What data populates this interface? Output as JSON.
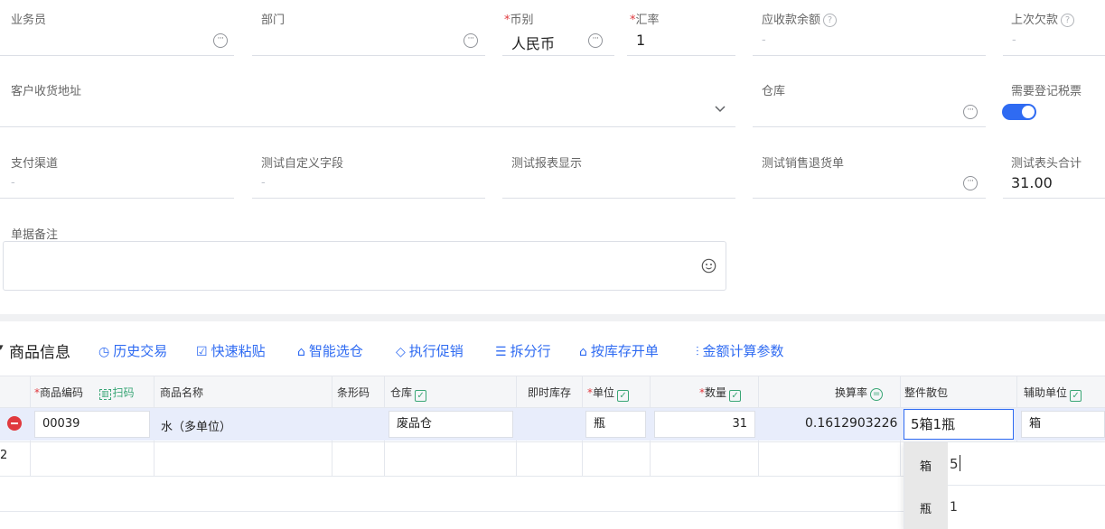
{
  "form": {
    "salesperson": {
      "label": "业务员"
    },
    "department": {
      "label": "部门"
    },
    "currency": {
      "label": "币别",
      "value": "人民币"
    },
    "exchange_rate": {
      "label": "汇率",
      "value": "1"
    },
    "receivable_balance": {
      "label": "应收款余额",
      "value": "-"
    },
    "last_owed": {
      "label": "上次欠款",
      "value": "-"
    },
    "customer_address": {
      "label": "客户收货地址"
    },
    "warehouse": {
      "label": "仓库"
    },
    "need_tax_invoice": {
      "label": "需要登记税票",
      "on": true
    },
    "payment_channel": {
      "label": "支付渠道",
      "value": "-"
    },
    "custom_field": {
      "label": "测试自定义字段",
      "value": "-"
    },
    "report_display": {
      "label": "测试报表显示"
    },
    "sales_return": {
      "label": "测试销售退货单"
    },
    "header_total": {
      "label": "测试表头合计",
      "value": "31.00"
    },
    "remarks": {
      "label": "单据备注"
    }
  },
  "section": {
    "title": "商品信息",
    "actions": [
      {
        "label": "历史交易",
        "icon": "clock-icon"
      },
      {
        "label": "快速粘贴",
        "icon": "paste-icon"
      },
      {
        "label": "智能选仓",
        "icon": "warehouse-icon"
      },
      {
        "label": "执行促销",
        "icon": "tag-icon"
      },
      {
        "label": "拆分行",
        "icon": "split-icon"
      },
      {
        "label": "按库存开单",
        "icon": "stock-icon"
      },
      {
        "label": "金额计算参数",
        "icon": "sliders-icon"
      }
    ]
  },
  "table": {
    "headers": {
      "code": "商品编码",
      "scan": "扫码",
      "name": "商品名称",
      "barcode": "条形码",
      "warehouse": "仓库",
      "stock": "即时库存",
      "unit": "单位",
      "qty": "数量",
      "rate": "换算率",
      "package": "整件散包",
      "aux_unit": "辅助单位"
    },
    "rows": [
      {
        "code": "00039",
        "name": "水（多单位）",
        "warehouse": "废品仓",
        "unit": "瓶",
        "qty": "31",
        "rate": "0.1612903226",
        "package": "5箱1瓶",
        "aux_unit": "箱"
      },
      {
        "index": "2"
      }
    ]
  },
  "popup": {
    "rows": [
      {
        "unit": "箱",
        "value": "5"
      },
      {
        "unit": "瓶",
        "value": "1"
      }
    ]
  }
}
